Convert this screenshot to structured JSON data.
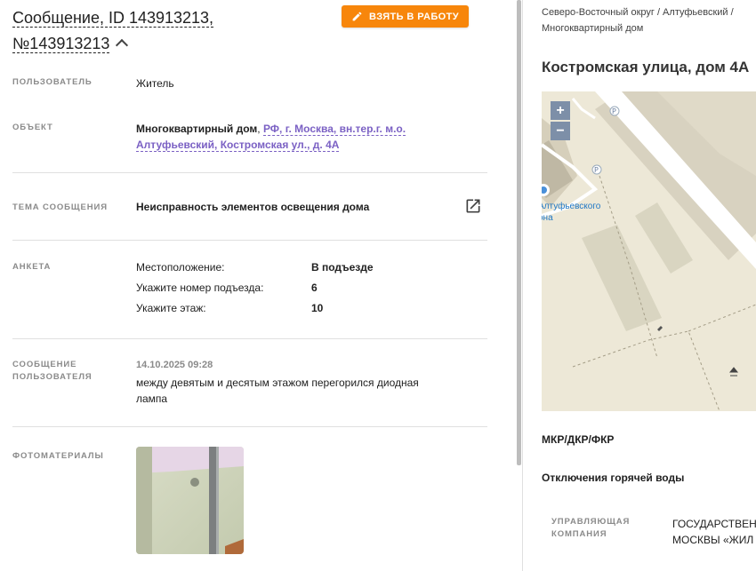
{
  "header": {
    "title_line1": "Сообщение, ID 143913213,",
    "title_line2": "№143913213",
    "take_button": "ВЗЯТЬ В РАБОТУ"
  },
  "fields": {
    "user": {
      "label": "ПОЛЬЗОВАТЕЛЬ",
      "value": "Житель"
    },
    "object": {
      "label": "ОБЪЕКТ",
      "type": "Многоквартирный дом",
      "sep": ", ",
      "address": "РФ, г. Москва, вн.тер.г. м.о. Алтуфьевский, Костромская ул., д. 4А"
    },
    "topic": {
      "label": "ТЕМА СООБЩЕНИЯ",
      "value": "Неисправность элементов освещения дома"
    },
    "survey": {
      "label": "АНКЕТА",
      "rows": [
        {
          "q": "Местоположение:",
          "a": "В подъезде"
        },
        {
          "q": "Укажите номер подъезда:",
          "a": "6"
        },
        {
          "q": "Укажите этаж:",
          "a": "10"
        }
      ]
    },
    "message": {
      "label_line1": "СООБЩЕНИЕ",
      "label_line2": "ПОЛЬЗОВАТЕЛЯ",
      "date": "14.10.2025 09:28",
      "text": "между девятым и десятым этажом перегорился диодная лампа"
    },
    "photos": {
      "label": "ФОТОМАТЕРИАЛЫ"
    }
  },
  "sidebar": {
    "breadcrumb": "Северо-Восточный округ / Алтуфьевский / Многоквартирный дом",
    "address": "Костромская улица, дом 4А",
    "map": {
      "zoom_in": "+",
      "zoom_out": "−",
      "label_line1": "Алтуфьевского",
      "label_line2": "она",
      "parking1": "P",
      "parking2": "P"
    },
    "section1": "МКР/ДКР/ФКР",
    "section2": "Отключения горячей воды",
    "uk": {
      "label_line1": "УПРАВЛЯЮЩАЯ",
      "label_line2": "КОМПАНИЯ",
      "value_line1": "ГОСУДАРСТВЕН",
      "value_line2": "МОСКВЫ «ЖИЛ"
    }
  },
  "colors": {
    "accent": "#f7860b",
    "link": "#7b61c4",
    "map_bg": "#ede8d7",
    "zoom_btn": "#7d8fa8"
  }
}
